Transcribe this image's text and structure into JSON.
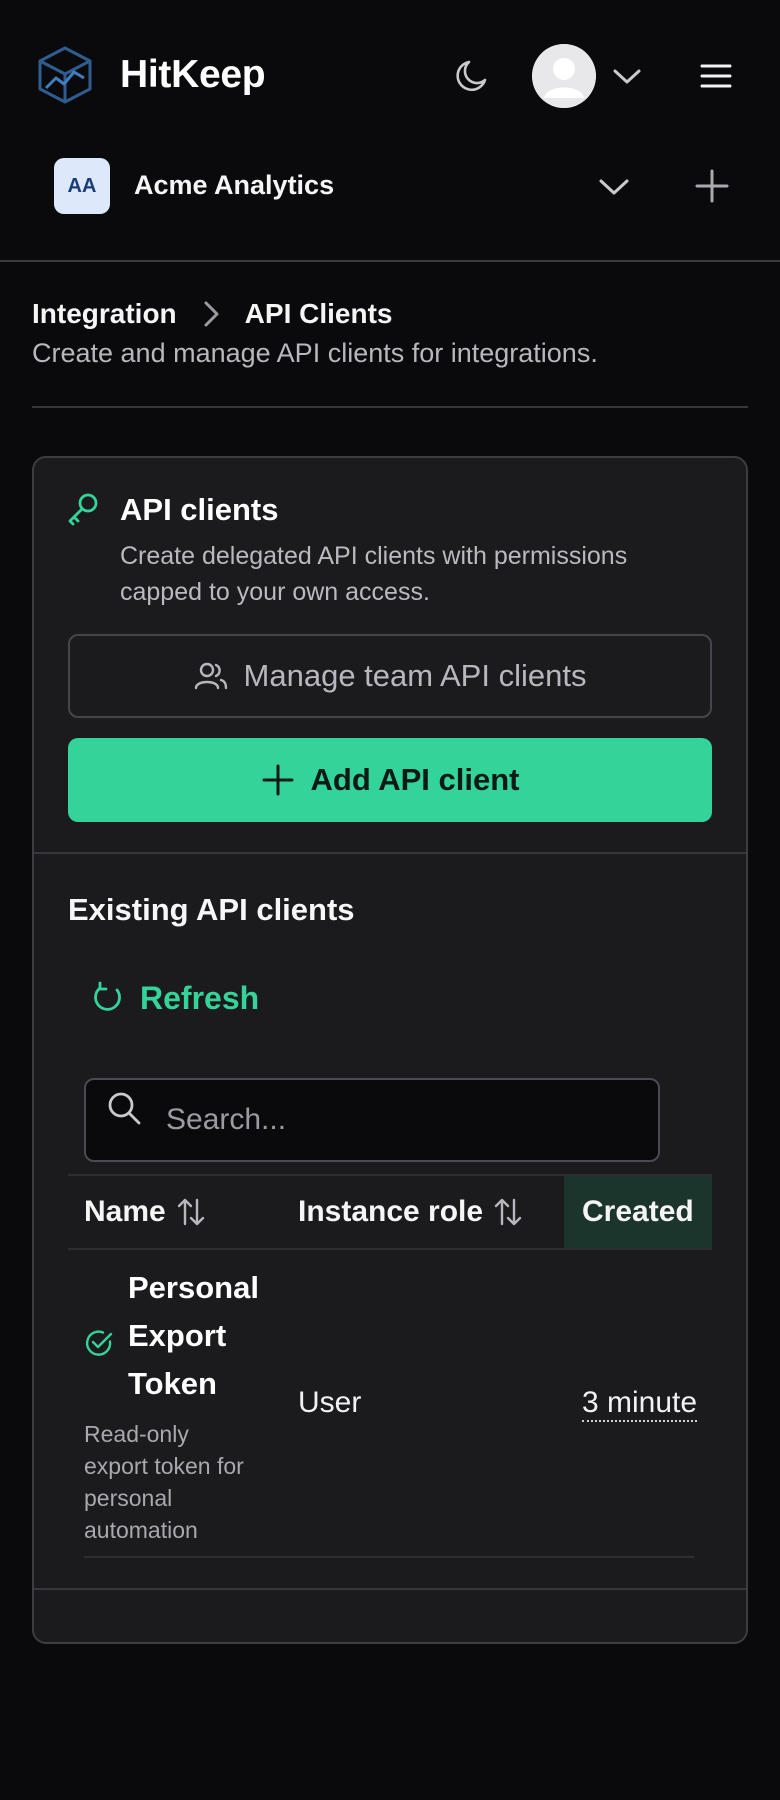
{
  "header": {
    "brand": "HitKeep",
    "icons": {
      "logo": "cube-chart-logo-icon",
      "theme": "moon-icon",
      "avatar": "user-avatar-icon",
      "avatar_menu": "chevron-down-icon",
      "menu": "hamburger-menu-icon"
    }
  },
  "workspace": {
    "initials": "AA",
    "name": "Acme Analytics",
    "icons": {
      "switch": "chevron-down-icon",
      "add": "plus-icon"
    }
  },
  "breadcrumb": {
    "items": [
      "Integration",
      "API Clients"
    ],
    "separator_icon": "chevron-right-icon"
  },
  "page": {
    "description": "Create and manage API clients for integrations."
  },
  "card": {
    "icon": "key-icon",
    "title": "API clients",
    "description": "Create delegated API clients with permissions capped to your own access.",
    "manage_button": {
      "label": "Manage team API clients",
      "icon": "users-icon"
    },
    "add_button": {
      "label": "Add API client",
      "icon": "plus-icon"
    },
    "section_title": "Existing API clients",
    "refresh_button": {
      "label": "Refresh",
      "icon": "refresh-icon"
    },
    "search": {
      "placeholder": "Search...",
      "value": "",
      "icon": "search-icon"
    },
    "table": {
      "columns": [
        "Name",
        "Instance role",
        "Created"
      ],
      "sort_icon": "sort-arrows-icon",
      "rows": [
        {
          "status_icon": "check-circle-icon",
          "name": "Personal Export Token",
          "description": "Read-only export token for personal automation",
          "role": "User",
          "created": "3 minute"
        }
      ]
    }
  },
  "colors": {
    "background": "#0a0a0c",
    "card": "#1b1b1e",
    "accent": "#34d399",
    "border": "#3c3c42",
    "muted_text": "#b7b7bd"
  }
}
